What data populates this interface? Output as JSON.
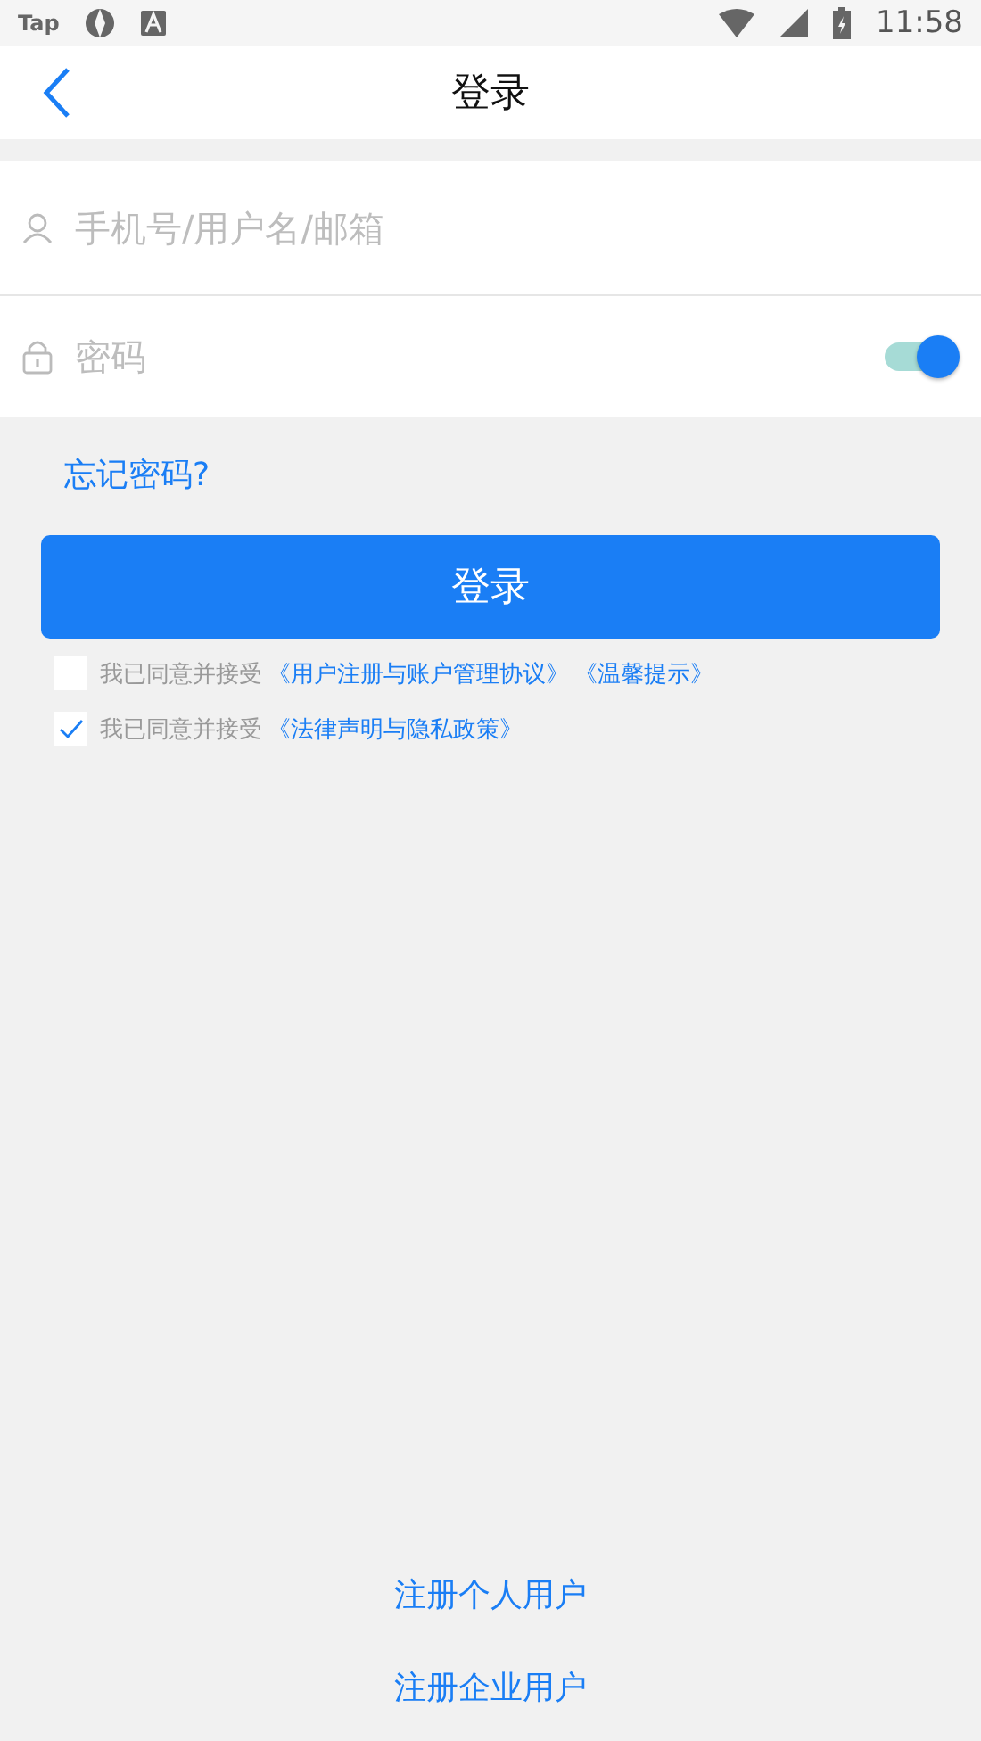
{
  "status_bar": {
    "app_label": "Tap",
    "time": "11:58"
  },
  "header": {
    "title": "登录"
  },
  "form": {
    "username": {
      "placeholder": "手机号/用户名/邮箱"
    },
    "password": {
      "placeholder": "密码",
      "show_password": {
        "on": true
      }
    }
  },
  "forgot_link": "忘记密码?",
  "login_button": "登录",
  "agreements": [
    {
      "checked": false,
      "text": "我已同意并接受",
      "links": [
        "《用户注册与账户管理协议》",
        "《温馨提示》"
      ]
    },
    {
      "checked": true,
      "text": "我已同意并接受",
      "links": [
        "《法律声明与隐私政策》"
      ]
    }
  ],
  "register_links": [
    "注册个人用户",
    "注册企业用户"
  ]
}
